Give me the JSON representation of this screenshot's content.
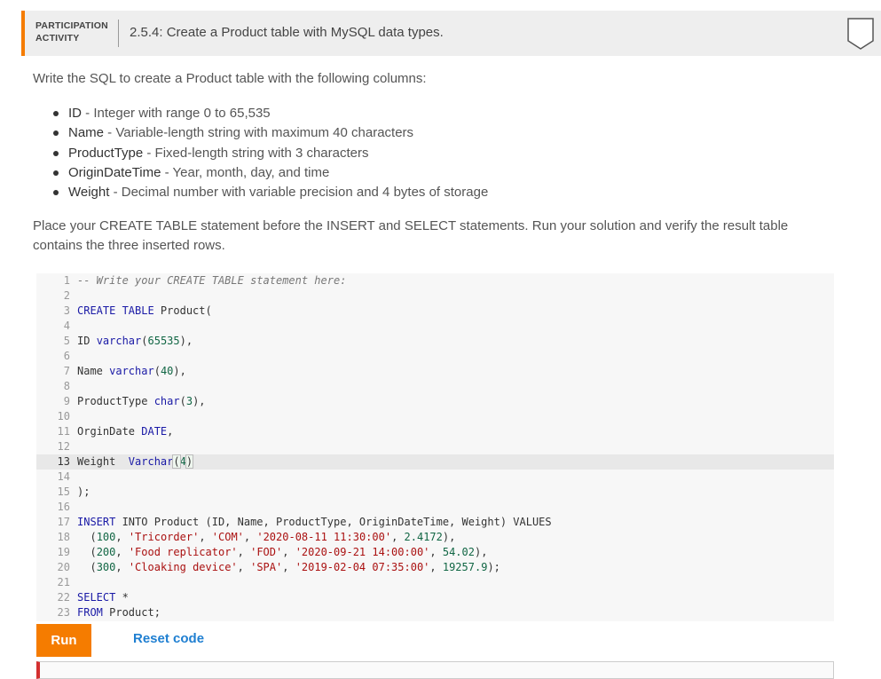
{
  "activity": {
    "label_line1": "PARTICIPATION",
    "label_line2": "ACTIVITY",
    "title": "2.5.4: Create a Product table with MySQL data types."
  },
  "intro": "Write the SQL to create a Product table with the following columns:",
  "columns": [
    {
      "name": "ID",
      "desc": " - Integer with range 0 to 65,535"
    },
    {
      "name": "Name",
      "desc": " - Variable-length string with maximum 40 characters"
    },
    {
      "name": "ProductType",
      "desc": " - Fixed-length string with 3 characters"
    },
    {
      "name": "OriginDateTime",
      "desc": " - Year, month, day, and time"
    },
    {
      "name": "Weight",
      "desc": " - Decimal number with variable precision and 4 bytes of storage"
    }
  ],
  "instructions": "Place your CREATE TABLE statement before the INSERT and SELECT statements. Run your solution and verify the result table contains the three inserted rows.",
  "code_lines": [
    {
      "n": "1"
    },
    {
      "n": "2"
    },
    {
      "n": "3"
    },
    {
      "n": "4"
    },
    {
      "n": "5"
    },
    {
      "n": "6"
    },
    {
      "n": "7"
    },
    {
      "n": "8"
    },
    {
      "n": "9"
    },
    {
      "n": "10"
    },
    {
      "n": "11"
    },
    {
      "n": "12"
    },
    {
      "n": "13"
    },
    {
      "n": "14"
    },
    {
      "n": "15"
    },
    {
      "n": "16"
    },
    {
      "n": "17"
    },
    {
      "n": "18"
    },
    {
      "n": "19"
    },
    {
      "n": "20"
    },
    {
      "n": "21"
    },
    {
      "n": "22"
    },
    {
      "n": "23"
    }
  ],
  "code": {
    "l1": "-- Write your CREATE TABLE statement here:",
    "l3_kw": "CREATE TABLE",
    "l3_rest": " Product(",
    "l5_a": "ID ",
    "l5_ty": "varchar",
    "l5_b": "(",
    "l5_num": "65535",
    "l5_c": "),",
    "l7_a": "Name ",
    "l7_ty": "varchar",
    "l7_b": "(",
    "l7_num": "40",
    "l7_c": "),",
    "l9_a": "ProductType ",
    "l9_ty": "char",
    "l9_b": "(",
    "l9_num": "3",
    "l9_c": "),",
    "l11_a": "OrginDate ",
    "l11_ty": "DATE",
    "l11_c": ",",
    "l13_a": "Weight  ",
    "l13_ty": "Varchar",
    "l13_b": "(",
    "l13_num": "4",
    "l13_c": ")",
    "l15": ");",
    "l17_kw": "INSERT",
    "l17_a": " INTO Product (ID, Name, ProductType, OriginDateTime, Weight) VALUES",
    "l18_a": "  (",
    "l18_n1": "100",
    "l18_b": ", ",
    "l18_s1": "'Tricorder'",
    "l18_c": ", ",
    "l18_s2": "'COM'",
    "l18_d": ", ",
    "l18_s3": "'2020-08-11 11:30:00'",
    "l18_e": ", ",
    "l18_n2": "2.4172",
    "l18_f": "),",
    "l19_a": "  (",
    "l19_n1": "200",
    "l19_b": ", ",
    "l19_s1": "'Food replicator'",
    "l19_c": ", ",
    "l19_s2": "'FOD'",
    "l19_d": ", ",
    "l19_s3": "'2020-09-21 14:00:00'",
    "l19_e": ", ",
    "l19_n2": "54.02",
    "l19_f": "),",
    "l20_a": "  (",
    "l20_n1": "300",
    "l20_b": ", ",
    "l20_s1": "'Cloaking device'",
    "l20_c": ", ",
    "l20_s2": "'SPA'",
    "l20_d": ", ",
    "l20_s3": "'2019-02-04 07:35:00'",
    "l20_e": ", ",
    "l20_n2": "19257.9",
    "l20_f": ");",
    "l22_kw": "SELECT",
    "l22_a": " *",
    "l23_kw": "FROM",
    "l23_a": " Product;"
  },
  "buttons": {
    "run": "Run",
    "reset": "Reset code"
  },
  "colors": {
    "accent": "#f57c00",
    "link": "#1f7fd1",
    "error_bar": "#d32f2f"
  }
}
